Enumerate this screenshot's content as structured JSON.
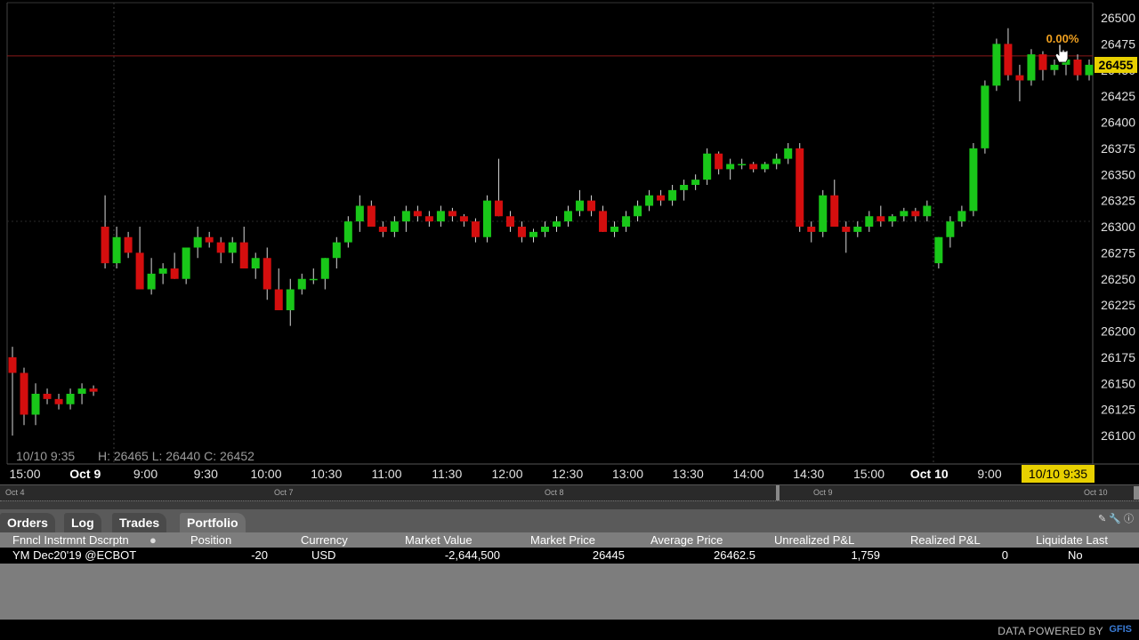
{
  "chart": {
    "ohlc_time": "10/10 9:35",
    "ohlc_values": "H: 26465  L: 26440  C: 26452",
    "last_price": "26455",
    "change_pct": "0.00%",
    "cursor_time": "10/10 9:35",
    "y_ticks": [
      26100,
      26125,
      26150,
      26175,
      26200,
      26225,
      26250,
      26275,
      26300,
      26325,
      26350,
      26375,
      26400,
      26425,
      26450,
      26475,
      26500
    ],
    "x_ticks": [
      {
        "label": "15:00",
        "bold": false
      },
      {
        "label": "Oct 9",
        "bold": true
      },
      {
        "label": "9:00",
        "bold": false
      },
      {
        "label": "9:30",
        "bold": false
      },
      {
        "label": "10:00",
        "bold": false
      },
      {
        "label": "10:30",
        "bold": false
      },
      {
        "label": "11:00",
        "bold": false
      },
      {
        "label": "11:30",
        "bold": false
      },
      {
        "label": "12:00",
        "bold": false
      },
      {
        "label": "12:30",
        "bold": false
      },
      {
        "label": "13:00",
        "bold": false
      },
      {
        "label": "13:30",
        "bold": false
      },
      {
        "label": "14:00",
        "bold": false
      },
      {
        "label": "14:30",
        "bold": false
      },
      {
        "label": "15:00",
        "bold": false
      },
      {
        "label": "Oct 10",
        "bold": true
      },
      {
        "label": "9:00",
        "bold": false
      }
    ],
    "up_color": "#19c719",
    "down_color": "#d40e0e",
    "price_line_color": "#8a1a1a",
    "last_price_color": "#e8d000",
    "change_color": "#f0a020"
  },
  "navigator": {
    "labels": [
      "Oct 4",
      "Oct 7",
      "Oct 8",
      "Oct 9",
      "Oct 10"
    ]
  },
  "panel": {
    "tabs": [
      "Orders",
      "Log",
      "Trades",
      "Portfolio"
    ],
    "active_tab": "Portfolio",
    "columns": [
      "Fnncl Instrmnt Dscrptn",
      "Position",
      "Currency",
      "Market Value",
      "Market Price",
      "Average Price",
      "Unrealized P&L",
      "Realized P&L",
      "Liquidate Last"
    ],
    "rows": [
      [
        "YM Dec20'19 @ECBOT",
        "-20",
        "USD",
        "-2,644,500",
        "26445",
        "26462.5",
        "1,759",
        "0",
        "No"
      ]
    ]
  },
  "footer": {
    "powered_by": "DATA POWERED BY",
    "logo": "GFIS"
  },
  "chart_data": {
    "type": "candlestick",
    "title": "",
    "xlabel": "",
    "ylabel": "",
    "ylim": [
      26085,
      26510
    ],
    "grid": false,
    "series": [
      {
        "values": [
          [
            26175,
            26185,
            26100,
            26160
          ],
          [
            26160,
            26165,
            26110,
            26120
          ],
          [
            26120,
            26150,
            26110,
            26140
          ],
          [
            26140,
            26145,
            26130,
            26135
          ],
          [
            26135,
            26140,
            26125,
            26130
          ],
          [
            26130,
            26145,
            26125,
            26140
          ],
          [
            26140,
            26150,
            26130,
            26145
          ],
          [
            26145,
            26148,
            26138,
            26142
          ],
          [
            26300,
            26330,
            26260,
            26265
          ],
          [
            26265,
            26300,
            26260,
            26290
          ],
          [
            26290,
            26295,
            26270,
            26275
          ],
          [
            26275,
            26300,
            26240,
            26240
          ],
          [
            26240,
            26270,
            26235,
            26255
          ],
          [
            26255,
            26265,
            26245,
            26260
          ],
          [
            26260,
            26275,
            26250,
            26250
          ],
          [
            26250,
            26280,
            26245,
            26280
          ],
          [
            26280,
            26300,
            26270,
            26290
          ],
          [
            26290,
            26295,
            26280,
            26285
          ],
          [
            26285,
            26290,
            26265,
            26275
          ],
          [
            26275,
            26290,
            26265,
            26285
          ],
          [
            26285,
            26300,
            26260,
            26260
          ],
          [
            26260,
            26275,
            26250,
            26270
          ],
          [
            26270,
            26280,
            26230,
            26240
          ],
          [
            26240,
            26260,
            26220,
            26220
          ],
          [
            26220,
            26250,
            26205,
            26240
          ],
          [
            26240,
            26255,
            26235,
            26250
          ],
          [
            26250,
            26260,
            26245,
            26250
          ],
          [
            26250,
            26270,
            26240,
            26270
          ],
          [
            26270,
            26290,
            26260,
            26285
          ],
          [
            26285,
            26310,
            26280,
            26305
          ],
          [
            26305,
            26330,
            26295,
            26320
          ],
          [
            26320,
            26325,
            26300,
            26300
          ],
          [
            26300,
            26305,
            26290,
            26295
          ],
          [
            26295,
            26310,
            26290,
            26305
          ],
          [
            26305,
            26320,
            26295,
            26315
          ],
          [
            26315,
            26320,
            26305,
            26310
          ],
          [
            26310,
            26315,
            26300,
            26305
          ],
          [
            26305,
            26320,
            26300,
            26315
          ],
          [
            26315,
            26318,
            26305,
            26310
          ],
          [
            26310,
            26312,
            26300,
            26305
          ],
          [
            26305,
            26308,
            26285,
            26290
          ],
          [
            26290,
            26330,
            26285,
            26325
          ],
          [
            26325,
            26365,
            26310,
            26310
          ],
          [
            26310,
            26315,
            26295,
            26300
          ],
          [
            26300,
            26305,
            26285,
            26290
          ],
          [
            26290,
            26298,
            26285,
            26295
          ],
          [
            26295,
            26305,
            26290,
            26300
          ],
          [
            26300,
            26310,
            26295,
            26305
          ],
          [
            26305,
            26320,
            26300,
            26315
          ],
          [
            26315,
            26335,
            26310,
            26325
          ],
          [
            26325,
            26330,
            26310,
            26315
          ],
          [
            26315,
            26320,
            26295,
            26295
          ],
          [
            26295,
            26305,
            26290,
            26300
          ],
          [
            26300,
            26315,
            26295,
            26310
          ],
          [
            26310,
            26325,
            26305,
            26320
          ],
          [
            26320,
            26335,
            26315,
            26330
          ],
          [
            26330,
            26335,
            26320,
            26325
          ],
          [
            26325,
            26340,
            26320,
            26335
          ],
          [
            26335,
            26345,
            26325,
            26340
          ],
          [
            26340,
            26350,
            26335,
            26345
          ],
          [
            26345,
            26375,
            26340,
            26370
          ],
          [
            26370,
            26372,
            26350,
            26355
          ],
          [
            26355,
            26365,
            26345,
            26360
          ],
          [
            26360,
            26365,
            26355,
            26360
          ],
          [
            26360,
            26362,
            26352,
            26355
          ],
          [
            26355,
            26362,
            26352,
            26360
          ],
          [
            26360,
            26370,
            26355,
            26365
          ],
          [
            26365,
            26380,
            26360,
            26375
          ],
          [
            26375,
            26380,
            26295,
            26300
          ],
          [
            26300,
            26305,
            26285,
            26295
          ],
          [
            26295,
            26335,
            26290,
            26330
          ],
          [
            26330,
            26345,
            26300,
            26300
          ],
          [
            26300,
            26305,
            26275,
            26295
          ],
          [
            26295,
            26305,
            26290,
            26300
          ],
          [
            26300,
            26315,
            26295,
            26310
          ],
          [
            26310,
            26320,
            26300,
            26305
          ],
          [
            26305,
            26312,
            26300,
            26310
          ],
          [
            26310,
            26318,
            26305,
            26315
          ],
          [
            26315,
            26318,
            26305,
            26310
          ],
          [
            26310,
            26325,
            26305,
            26320
          ],
          [
            26265,
            26290,
            26260,
            26290
          ],
          [
            26290,
            26310,
            26280,
            26305
          ],
          [
            26305,
            26320,
            26300,
            26315
          ],
          [
            26315,
            26380,
            26310,
            26375
          ],
          [
            26375,
            26440,
            26370,
            26435
          ],
          [
            26435,
            26480,
            26430,
            26475
          ],
          [
            26475,
            26490,
            26440,
            26445
          ],
          [
            26445,
            26455,
            26420,
            26440
          ],
          [
            26440,
            26470,
            26435,
            26465
          ],
          [
            26465,
            26468,
            26440,
            26450
          ],
          [
            26450,
            26460,
            26445,
            26455
          ],
          [
            26455,
            26465,
            26445,
            26460
          ],
          [
            26460,
            26465,
            26440,
            26445
          ],
          [
            26445,
            26460,
            26440,
            26455
          ]
        ]
      }
    ]
  }
}
